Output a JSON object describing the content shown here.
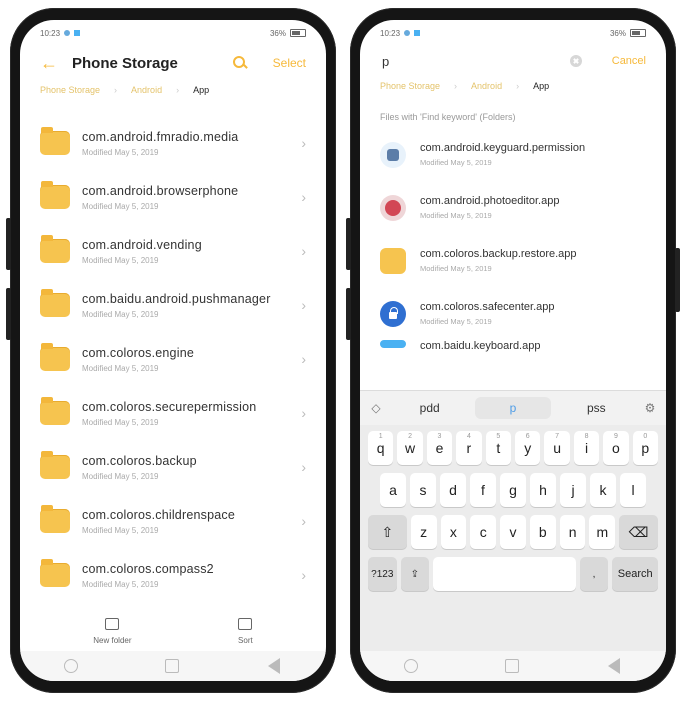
{
  "left": {
    "status": {
      "time": "10:23",
      "right": "36%"
    },
    "title": "Phone Storage",
    "action": "Select",
    "breadcrumbs": [
      "Phone Storage",
      "Android",
      "App"
    ],
    "rows": [
      {
        "name": "com.android.fmradio.media",
        "date": "Modified May 5, 2019"
      },
      {
        "name": "com.android.browserphone",
        "date": "Modified May 5, 2019"
      },
      {
        "name": "com.android.vending",
        "date": "Modified May 5, 2019"
      },
      {
        "name": "com.baidu.android.pushmanager",
        "date": "Modified May 5, 2019"
      },
      {
        "name": "com.coloros.engine",
        "date": "Modified May 5, 2019"
      },
      {
        "name": "com.coloros.securepermission",
        "date": "Modified May 5, 2019"
      },
      {
        "name": "com.coloros.backup",
        "date": "Modified May 5, 2019"
      },
      {
        "name": "com.coloros.childrenspace",
        "date": "Modified May 5, 2019"
      },
      {
        "name": "com.coloros.compass2",
        "date": "Modified May 5, 2019"
      }
    ],
    "tools": [
      {
        "label": "New folder"
      },
      {
        "label": "Sort"
      }
    ]
  },
  "right": {
    "status": {
      "time": "10:23",
      "right": "36%"
    },
    "search_value": "p",
    "cancel": "Cancel",
    "breadcrumbs": [
      "Phone Storage",
      "Android",
      "App"
    ],
    "heading": "Files with 'Find keyword' (Folders)",
    "results": [
      {
        "name": "com.android.keyguard.permission",
        "date": "Modified May 5, 2019",
        "icon": "app-android"
      },
      {
        "name": "com.android.photoeditor.app",
        "date": "Modified May 5, 2019",
        "icon": "app-red"
      },
      {
        "name": "com.coloros.backup.restore.app",
        "date": "Modified May 5, 2019",
        "icon": "folder"
      },
      {
        "name": "com.coloros.safecenter.app",
        "date": "Modified May 5, 2019",
        "icon": "lock"
      }
    ],
    "partial_result": "com.baidu.keyboard.app",
    "keyboard": {
      "suggestions": [
        "pdd",
        "p",
        "pss"
      ],
      "row1": [
        "q",
        "w",
        "e",
        "r",
        "t",
        "y",
        "u",
        "i",
        "o",
        "p"
      ],
      "row2": [
        "a",
        "s",
        "d",
        "f",
        "g",
        "h",
        "j",
        "k",
        "l"
      ],
      "row3": [
        "⇧",
        "z",
        "x",
        "c",
        "v",
        "b",
        "n",
        "m",
        "⌫"
      ],
      "row4": [
        "?123",
        "⇪",
        "",
        ",",
        "Search"
      ]
    }
  }
}
